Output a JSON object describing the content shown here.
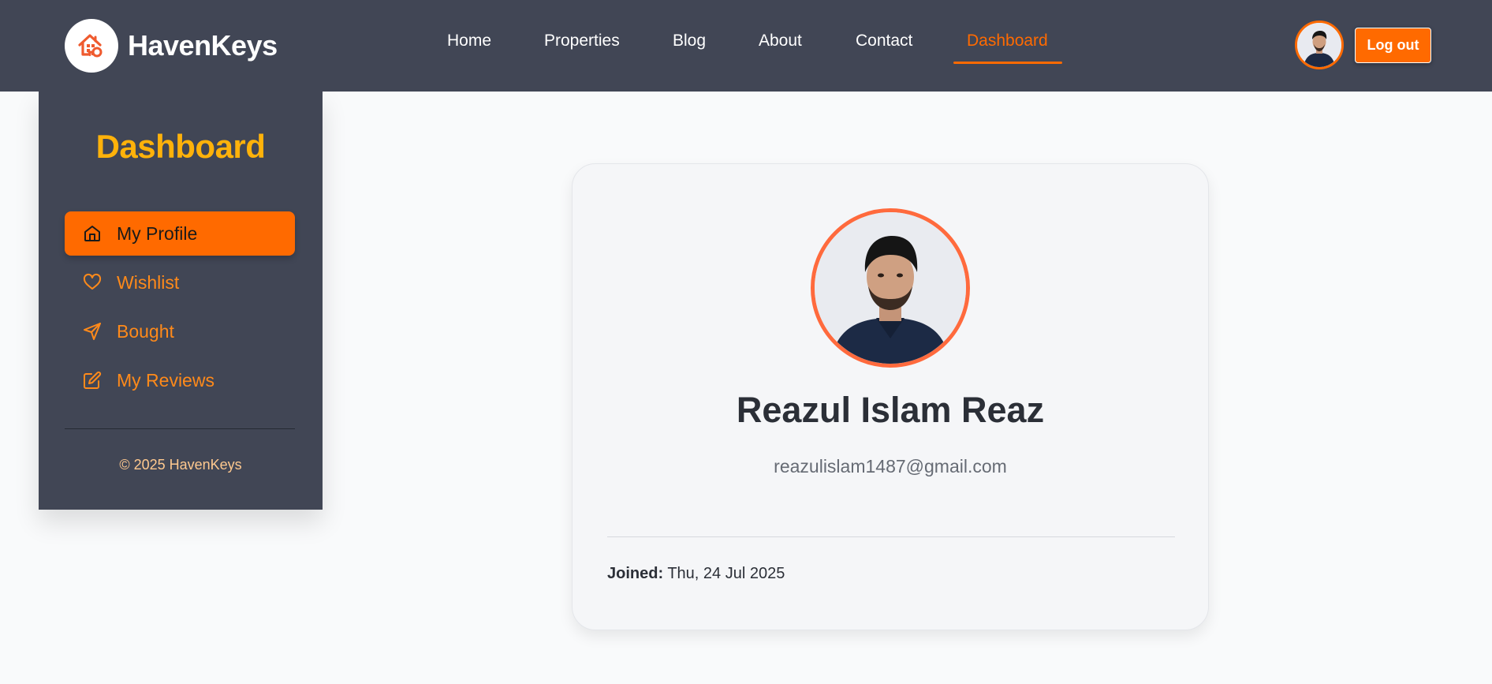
{
  "brand": {
    "name": "HavenKeys",
    "logo_icon": "house-key-icon",
    "accent": "#ff6a00"
  },
  "nav": {
    "links": [
      {
        "label": "Home"
      },
      {
        "label": "Properties"
      },
      {
        "label": "Blog"
      },
      {
        "label": "About"
      },
      {
        "label": "Contact"
      },
      {
        "label": "Dashboard",
        "active": true
      }
    ],
    "logout_label": "Log out"
  },
  "sidebar": {
    "title": "Dashboard",
    "title_color": "#ffb20a",
    "items": [
      {
        "label": "My Profile",
        "icon": "home-icon",
        "active": true
      },
      {
        "label": "Wishlist",
        "icon": "heart-icon"
      },
      {
        "label": "Bought",
        "icon": "send-icon"
      },
      {
        "label": "My Reviews",
        "icon": "edit-icon"
      }
    ],
    "copyright": "© 2025 HavenKeys"
  },
  "profile": {
    "name": "Reazul Islam Reaz",
    "email": "reazulislam1487@gmail.com",
    "joined_label": "Joined:",
    "joined_value": "Thu, 24 Jul 2025"
  }
}
